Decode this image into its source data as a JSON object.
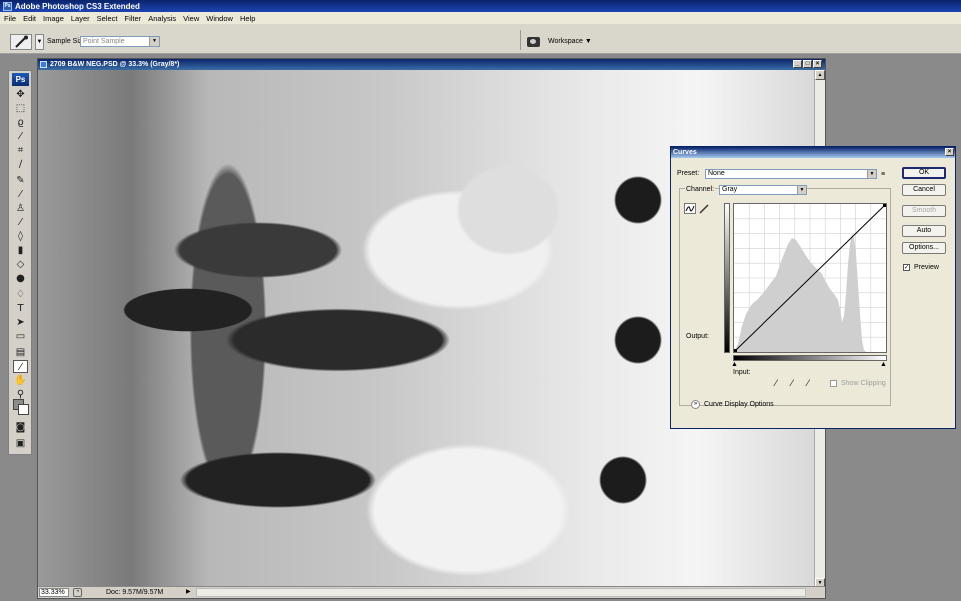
{
  "app": {
    "title": "Adobe Photoshop CS3 Extended",
    "icon": "ps-app-icon"
  },
  "menu": [
    "File",
    "Edit",
    "Image",
    "Layer",
    "Select",
    "Filter",
    "Analysis",
    "View",
    "Window",
    "Help"
  ],
  "options": {
    "sample_size_label": "Sample Size:",
    "sample_size_value": "Point Sample",
    "workspace_label": "Workspace ▼"
  },
  "tools": {
    "logo": "Ps"
  },
  "document": {
    "title": "2709 B&W NEG.PSD @ 33.3% (Gray/8*)",
    "zoom": "33.33%",
    "doc_info": "Doc: 9.57M/9.57M"
  },
  "curves": {
    "title": "Curves",
    "preset_label": "Preset:",
    "preset_value": "None",
    "channel_label": "Channel:",
    "channel_value": "Gray",
    "output_label": "Output:",
    "input_label": "Input:",
    "show_clipping_label": "Show Clipping",
    "curve_display_label": "Curve Display Options",
    "buttons": {
      "ok": "OK",
      "cancel": "Cancel",
      "smooth": "Smooth",
      "auto": "Auto",
      "options": "Options..."
    },
    "preview_label": "Preview",
    "preview_checked": true,
    "show_clipping_checked": false
  }
}
